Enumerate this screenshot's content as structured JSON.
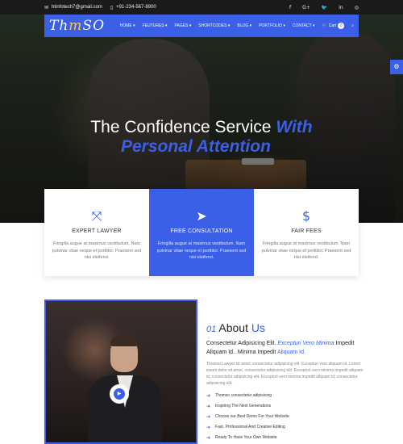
{
  "topbar": {
    "email": "htinfotech7@gmail.com",
    "phone": "+91-234-567-8900",
    "social": [
      {
        "icon": "facebook-icon",
        "glyph": "f"
      },
      {
        "icon": "google-plus-icon",
        "glyph": "G+"
      },
      {
        "icon": "twitter-icon",
        "glyph": "🐦"
      },
      {
        "icon": "linkedin-icon",
        "glyph": "in"
      },
      {
        "icon": "instagram-icon",
        "glyph": "◎"
      }
    ]
  },
  "navbar": {
    "logo_left": "Th",
    "logo_o": "m",
    "logo_right": "SO",
    "menu": [
      "HOME ▾",
      "FEUTURES ▾",
      "PAGES ▾",
      "SHORTCODES ▾",
      "BLOG ▾",
      "PORTFOLIO ▾",
      "CONTACT ▾"
    ],
    "cart_label": "Cart",
    "cart_count": "0"
  },
  "hero": {
    "title_main": "The Confidence Service",
    "title_accent": "With",
    "subtitle": "Personal Attention"
  },
  "features": [
    {
      "icon": "expand-arrows-icon",
      "glyph": "⤧",
      "title": "EXPERT LAWYER",
      "text": "Fringilla augue at maximus vestibulum. Nam pulvinar vitae neque et porttitor. Praesent sed nisi eleifend."
    },
    {
      "icon": "paper-plane-icon",
      "glyph": "➤",
      "title": "FREE CONSULTATION",
      "text": "Fringilla augue at maximus vestibulum. Nam pulvinar vitae neque et porttitor. Praesent sed nisi eleifend."
    },
    {
      "icon": "dollar-icon",
      "glyph": "$",
      "title": "FAIR FEES",
      "text": "Fringilla augue at maximus vestibulum. Nam pulvinar vitae neque et porttitor. Praesent sed nisi eleifend."
    }
  ],
  "about": {
    "number": "01",
    "heading": "About",
    "heading_accent": "Us",
    "lead_1": "Consectetur Adipisicing Elit.",
    "lead_italic": "Excepturi Vero Minima",
    "lead_2": "Impedit Aliquam Id.. Minima Impedit",
    "lead_highlight": "Aliquam Id.",
    "body": "Thoniso Lawyer sit amet, consectetur adipisicing elit. Excepturi vero aliquam id. Lorem ipsum dolor sit amet, consectetur adipisicing elit. Excepturi vero minima impedit aliquam id, consectetur adipisicing elit. Excepturi vero minima impedit aliquam id, consectetur adipisicing elit.",
    "list": [
      "Thomso consectetur adipisicing",
      "Inspiring The Next Generations",
      "Choose our Best Demo For Your Website",
      "Fast, Professional And Creative Editing",
      "Ready To Have Your Own Website"
    ]
  },
  "colors": {
    "accent": "#3b5fe6",
    "topbar": "#1a1a1a",
    "logo_o": "#ffcf2e"
  }
}
